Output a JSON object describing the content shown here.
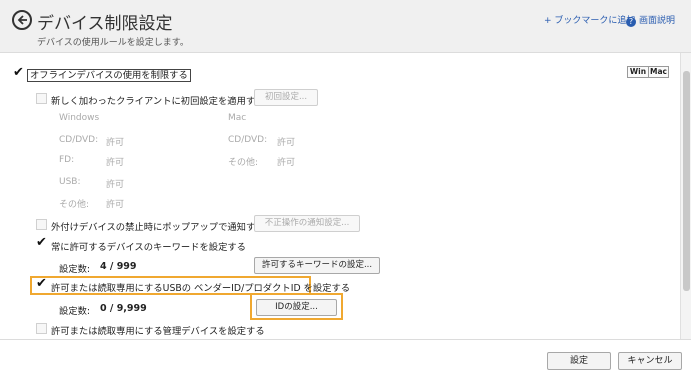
{
  "header": {
    "title": "デバイス制限設定",
    "subtitle": "デバイスの使用ルールを設定します。",
    "bookmark_link": "+ ブックマークに追加",
    "help_link": "画面説明",
    "help_icon": "?"
  },
  "os_toggle": {
    "win": "Win",
    "mac": "Mac"
  },
  "offline": {
    "label": "オフラインデバイスの使用を制限する",
    "checked": true,
    "new_client": {
      "label": "新しく加わったクライアントに初回設定を適用する",
      "button": "初回設定...",
      "windows": {
        "heading": "Windows",
        "rows": [
          {
            "name": "CD/DVD:",
            "value": "許可"
          },
          {
            "name": "FD:",
            "value": "許可"
          },
          {
            "name": "USB:",
            "value": "許可"
          },
          {
            "name": "その他:",
            "value": "許可"
          }
        ]
      },
      "mac": {
        "heading": "Mac",
        "rows": [
          {
            "name": "CD/DVD:",
            "value": "許可"
          },
          {
            "name": "その他:",
            "value": "許可"
          }
        ]
      }
    },
    "popup": {
      "label": "外付けデバイスの禁止時にポップアップで通知する",
      "button": "不正操作の通知設定..."
    },
    "keyword": {
      "label": "常に許可するデバイスのキーワードを設定する",
      "checked": true,
      "count_label": "設定数:",
      "count_value": "4 / 999",
      "button": "許可するキーワードの設定..."
    },
    "usb_id": {
      "label": "許可または読取専用にするUSBの ベンダーID/プロダクトID を設定する",
      "checked": true,
      "count_label": "設定数:",
      "count_value": "0 / 9,999",
      "button": "IDの設定..."
    },
    "managed": {
      "label": "許可または読取専用にする管理デバイスを設定する",
      "checked": false
    }
  },
  "footer": {
    "ok": "設定",
    "cancel": "キャンセル"
  },
  "colors": {
    "highlight": "#f0a830",
    "link": "#2a5db0"
  }
}
